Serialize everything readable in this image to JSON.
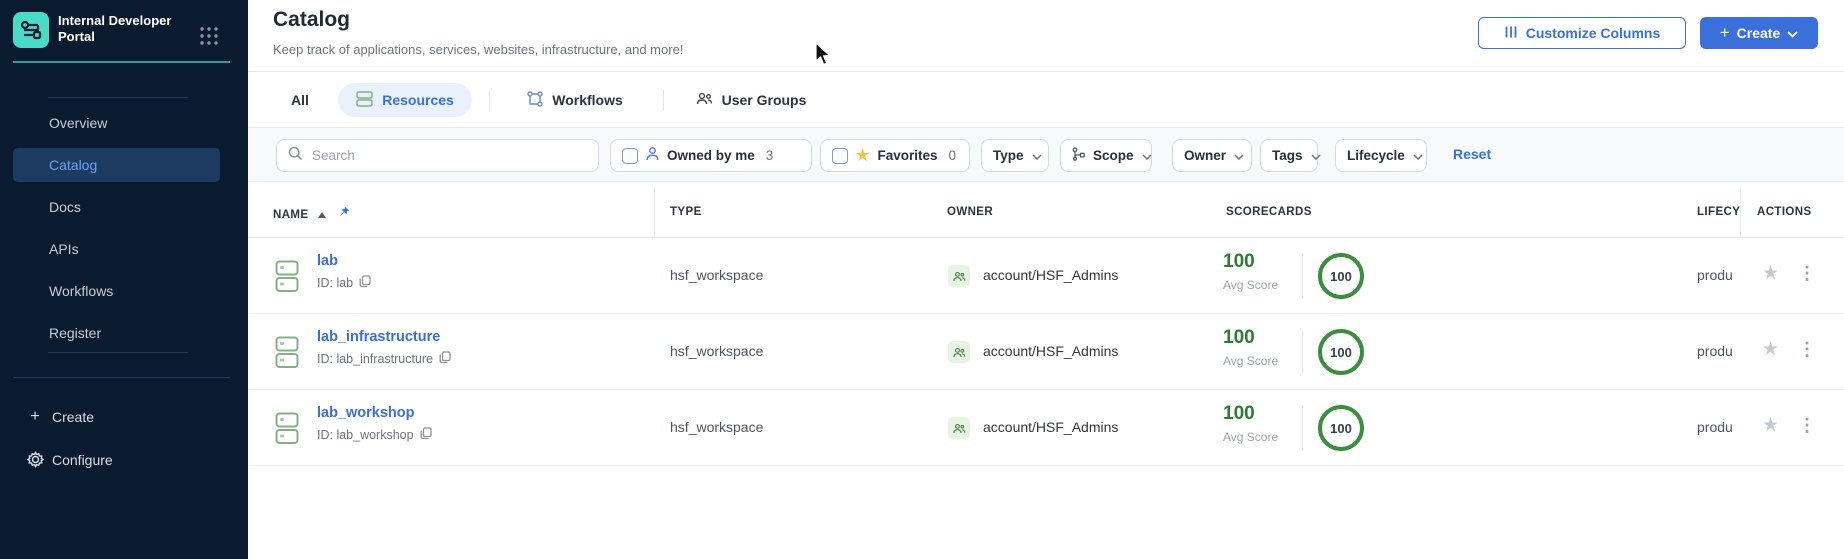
{
  "colors": {
    "accent_blue": "#3b6fd9",
    "brand_teal": "#46dcc7",
    "score_green": "#2e7d32",
    "sidebar_bg": "#0b1b2f"
  },
  "sidebar": {
    "brand_title": "Internal Developer Portal",
    "items": [
      {
        "label": "Overview"
      },
      {
        "label": "Catalog"
      },
      {
        "label": "Docs"
      },
      {
        "label": "APIs"
      },
      {
        "label": "Workflows"
      },
      {
        "label": "Register"
      }
    ],
    "create_label": "Create",
    "configure_label": "Configure"
  },
  "header": {
    "title": "Catalog",
    "subtitle": "Keep track of applications, services, websites, infrastructure, and more!",
    "customize_columns_label": "Customize Columns",
    "create_label": "Create"
  },
  "tabs": [
    {
      "label": "All"
    },
    {
      "label": "Resources"
    },
    {
      "label": "Workflows"
    },
    {
      "label": "User Groups"
    }
  ],
  "filters": {
    "search_placeholder": "Search",
    "owned_by_me": {
      "label": "Owned by me",
      "count": "3"
    },
    "favorites": {
      "label": "Favorites",
      "count": "0"
    },
    "dropdowns": [
      "Type",
      "Scope",
      "Owner",
      "Tags",
      "Lifecycle"
    ],
    "reset_label": "Reset"
  },
  "table": {
    "columns": [
      "NAME",
      "TYPE",
      "OWNER",
      "SCORECARDS",
      "LIFECY",
      "ACTIONS"
    ],
    "rows": [
      {
        "name": "lab",
        "id": "ID: lab",
        "type": "hsf_workspace",
        "owner": "account/HSF_Admins",
        "avg_score": "100",
        "avg_score_label": "Avg Score",
        "score_badge": "100",
        "lifecycle": "produ"
      },
      {
        "name": "lab_infrastructure",
        "id": "ID: lab_infrastructure",
        "type": "hsf_workspace",
        "owner": "account/HSF_Admins",
        "avg_score": "100",
        "avg_score_label": "Avg Score",
        "score_badge": "100",
        "lifecycle": "produ"
      },
      {
        "name": "lab_workshop",
        "id": "ID: lab_workshop",
        "type": "hsf_workspace",
        "owner": "account/HSF_Admins",
        "avg_score": "100",
        "avg_score_label": "Avg Score",
        "score_badge": "100",
        "lifecycle": "produ"
      }
    ]
  }
}
